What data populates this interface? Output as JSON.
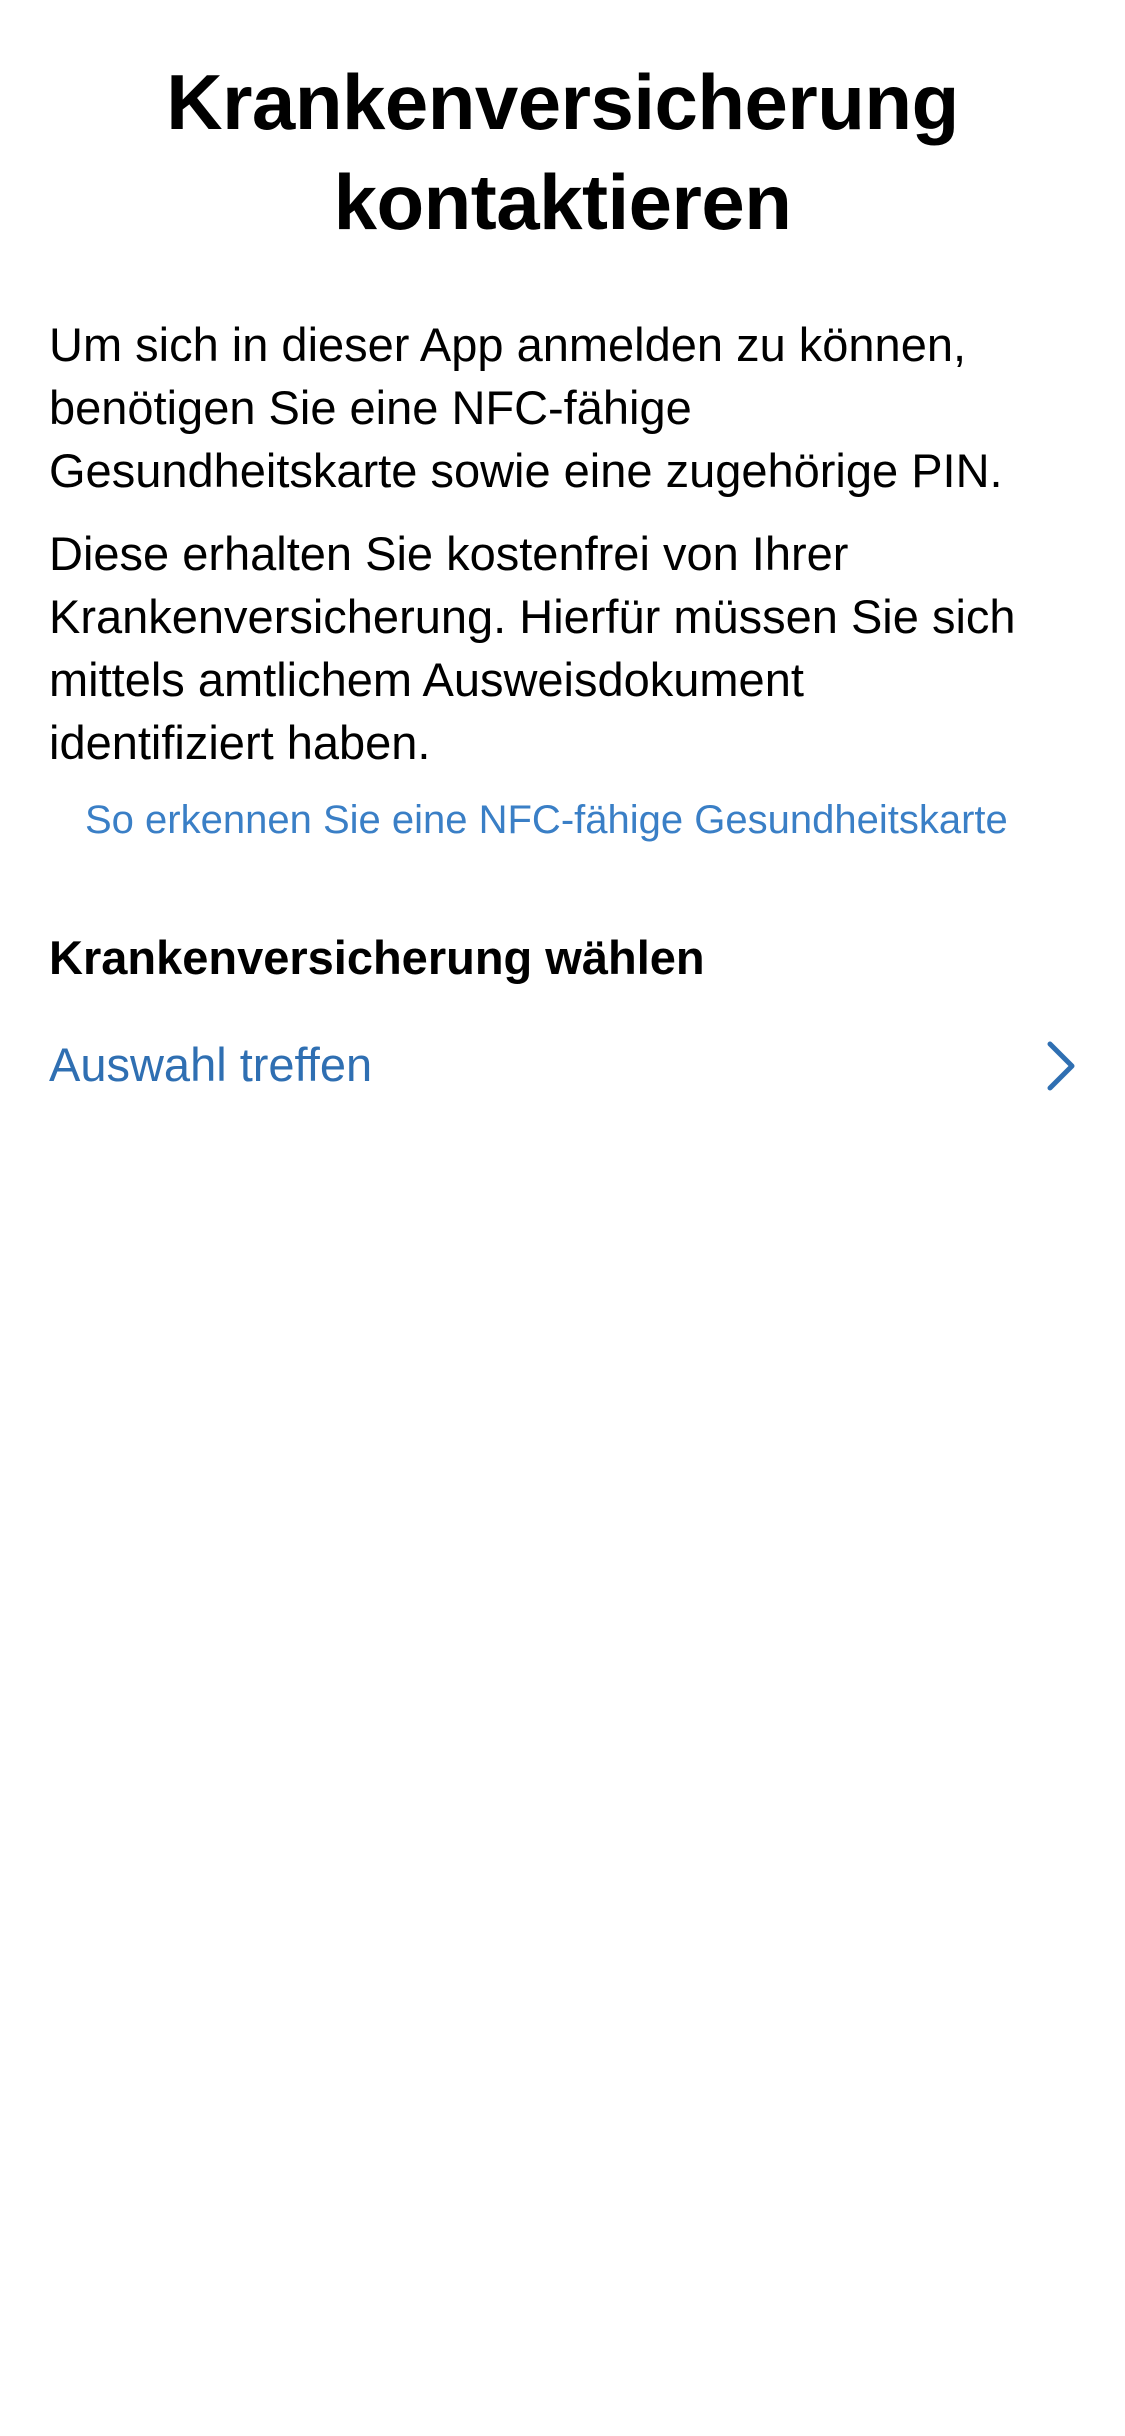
{
  "header": {
    "title_line_1": "Krankenversicherung",
    "title_line_2": "kontaktieren"
  },
  "intro": {
    "paragraph_1_lines": [
      "Um sich in dieser App anmelden zu können,",
      "benötigen Sie eine NFC-fähige",
      "Gesundheitskarte sowie eine zugehörige PIN."
    ],
    "paragraph_2_lines": [
      "Diese erhalten Sie kostenfrei von Ihrer",
      "Krankenversicherung. Hierfür müssen Sie sich",
      "mittels amtlichem Ausweisdokument",
      "identifiziert haben."
    ],
    "nfc_link_label": "So erkennen Sie eine NFC-fähige Gesundheitskarte"
  },
  "insurance_selection": {
    "heading": "Krankenversicherung wählen",
    "select_label": "Auswahl treffen",
    "chevron_icon": "chevron-right-icon"
  },
  "colors": {
    "link": "#3a7fc6",
    "select": "#2f6fb2",
    "text": "#000000",
    "background": "#ffffff"
  }
}
